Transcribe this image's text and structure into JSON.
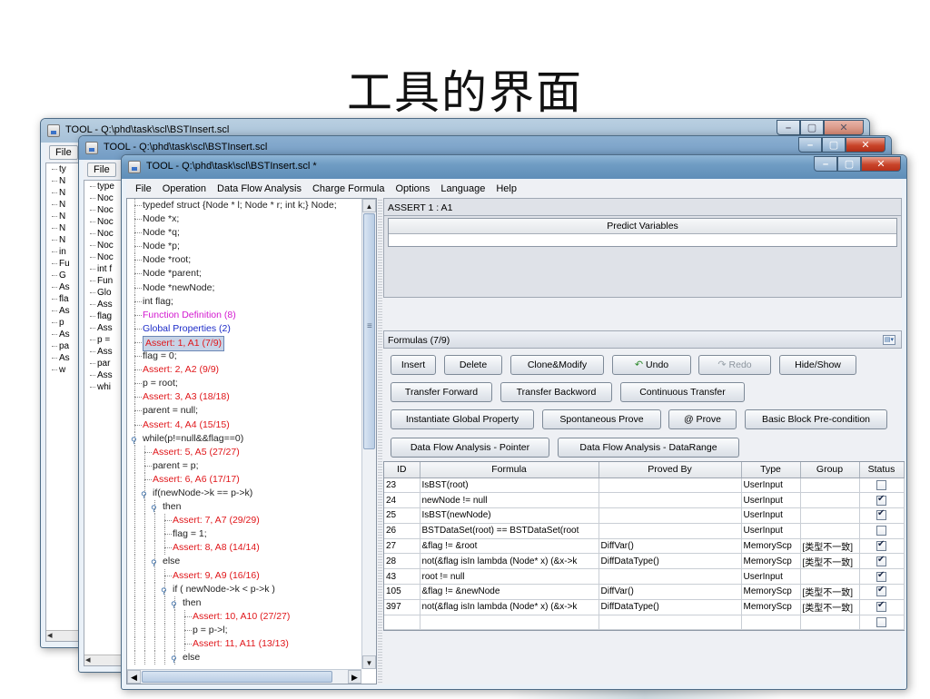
{
  "slide": {
    "title": "工具的界面"
  },
  "windows": {
    "back1": {
      "title": "TOOL - Q:\\phd\\task\\scl\\BSTInsert.scl",
      "menu_file": "File",
      "tree_lines": [
        "ty",
        "N",
        "N",
        "N",
        "N",
        "N",
        "N",
        "in",
        "Fu",
        "G",
        "As",
        "fla",
        "As",
        "p",
        "As",
        "pa",
        "As",
        "w"
      ]
    },
    "back2": {
      "title": "TOOL - Q:\\phd\\task\\scl\\BSTInsert.scl",
      "menu_file": "File",
      "tree_lines": [
        "type",
        "Noc",
        "Noc",
        "Noc",
        "Noc",
        "Noc",
        "Noc",
        "int f",
        "Fun",
        "Glo",
        "Ass",
        "flag",
        "Ass",
        "p =",
        "Ass",
        "par",
        "Ass",
        "whi"
      ]
    },
    "front": {
      "title": "TOOL - Q:\\phd\\task\\scl\\BSTInsert.scl *",
      "menu": [
        "File",
        "Operation",
        "Data Flow Analysis",
        "Charge Formula",
        "Options",
        "Language",
        "Help"
      ]
    }
  },
  "tree": [
    {
      "text": "typedef struct {Node * l; Node * r; int k;} Node;",
      "level": 0,
      "color": "default"
    },
    {
      "text": "Node *x;",
      "level": 0,
      "color": "default"
    },
    {
      "text": "Node *q;",
      "level": 0,
      "color": "default"
    },
    {
      "text": "Node *p;",
      "level": 0,
      "color": "default"
    },
    {
      "text": "Node *root;",
      "level": 0,
      "color": "default"
    },
    {
      "text": "Node *parent;",
      "level": 0,
      "color": "default"
    },
    {
      "text": "Node *newNode;",
      "level": 0,
      "color": "default"
    },
    {
      "text": "int flag;",
      "level": 0,
      "color": "default"
    },
    {
      "text": "Function Definition (8)",
      "level": 0,
      "color": "magenta"
    },
    {
      "text": "Global Properties (2)",
      "level": 0,
      "color": "blue"
    },
    {
      "text": "Assert: 1, A1 (7/9)",
      "level": 0,
      "color": "red",
      "selected": true
    },
    {
      "text": "flag = 0;",
      "level": 0,
      "color": "default"
    },
    {
      "text": "Assert: 2, A2 (9/9)",
      "level": 0,
      "color": "red"
    },
    {
      "text": "p = root;",
      "level": 0,
      "color": "default"
    },
    {
      "text": "Assert: 3, A3 (18/18)",
      "level": 0,
      "color": "red"
    },
    {
      "text": "parent = null;",
      "level": 0,
      "color": "default"
    },
    {
      "text": "Assert: 4, A4 (15/15)",
      "level": 0,
      "color": "red"
    },
    {
      "text": "while(p!=null&&flag==0)",
      "level": 0,
      "color": "default",
      "expand": true
    },
    {
      "text": "Assert: 5, A5 (27/27)",
      "level": 1,
      "color": "red"
    },
    {
      "text": "parent = p;",
      "level": 1,
      "color": "default"
    },
    {
      "text": "Assert: 6, A6 (17/17)",
      "level": 1,
      "color": "red"
    },
    {
      "text": "if(newNode->k == p->k)",
      "level": 1,
      "color": "default",
      "expand": true
    },
    {
      "text": "then",
      "level": 2,
      "color": "default",
      "expand": true
    },
    {
      "text": "Assert: 7, A7 (29/29)",
      "level": 3,
      "color": "red"
    },
    {
      "text": "flag = 1;",
      "level": 3,
      "color": "default"
    },
    {
      "text": "Assert: 8, A8 (14/14)",
      "level": 3,
      "color": "red"
    },
    {
      "text": "else",
      "level": 2,
      "color": "default",
      "expand": true
    },
    {
      "text": "Assert: 9, A9 (16/16)",
      "level": 3,
      "color": "red"
    },
    {
      "text": "if ( newNode->k < p->k )",
      "level": 3,
      "color": "default",
      "expand": true
    },
    {
      "text": "then",
      "level": 4,
      "color": "default",
      "expand": true
    },
    {
      "text": "Assert: 10, A10 (27/27)",
      "level": 5,
      "color": "red"
    },
    {
      "text": "p = p->l;",
      "level": 5,
      "color": "default"
    },
    {
      "text": "Assert: 11, A11 (13/13)",
      "level": 5,
      "color": "red"
    },
    {
      "text": "else",
      "level": 4,
      "color": "default",
      "expand": true
    }
  ],
  "assert_panel": {
    "header": "ASSERT 1 : A1",
    "predict_header": "Predict Variables"
  },
  "formulas_panel": {
    "title": "Formulas (7/9)"
  },
  "buttons": {
    "insert": "Insert",
    "delete": "Delete",
    "clone_modify": "Clone&Modify",
    "undo": "Undo",
    "redo": "Redo",
    "hide_show": "Hide/Show",
    "transfer_forward": "Transfer Forward",
    "transfer_backword": "Transfer Backword",
    "continuous_transfer": "Continuous Transfer",
    "instantiate_global_property": "Instantiate Global Property",
    "spontaneous_prove": "Spontaneous Prove",
    "at_prove": "@ Prove",
    "basic_block_precondition": "Basic Block Pre-condition",
    "dfa_pointer": "Data Flow Analysis - Pointer",
    "dfa_datarange": "Data Flow Analysis - DataRange"
  },
  "table": {
    "columns": [
      "ID",
      "Formula",
      "Proved By",
      "Type",
      "Group",
      "Status"
    ],
    "rows": [
      {
        "id": "23",
        "formula": "IsBST(root)",
        "proved_by": "",
        "type": "UserInput",
        "group": "",
        "status": false
      },
      {
        "id": "24",
        "formula": "newNode != null",
        "proved_by": "",
        "type": "UserInput",
        "group": "",
        "status": true
      },
      {
        "id": "25",
        "formula": "IsBST(newNode)",
        "proved_by": "",
        "type": "UserInput",
        "group": "",
        "status": true
      },
      {
        "id": "26",
        "formula": "BSTDataSet(root) == BSTDataSet(root",
        "proved_by": "",
        "type": "UserInput",
        "group": "",
        "status": false
      },
      {
        "id": "27",
        "formula": "&flag != &root",
        "proved_by": "DiffVar()",
        "type": "MemoryScp",
        "group": "[类型不一致]",
        "status": true
      },
      {
        "id": "28",
        "formula": "not(&flag isIn lambda (Node* x) (&x->k",
        "proved_by": "DiffDataType()",
        "type": "MemoryScp",
        "group": "[类型不一致]",
        "status": true
      },
      {
        "id": "43",
        "formula": "root != null",
        "proved_by": "",
        "type": "UserInput",
        "group": "",
        "status": true
      },
      {
        "id": "105",
        "formula": "&flag != &newNode",
        "proved_by": "DiffVar()",
        "type": "MemoryScp",
        "group": "[类型不一致]",
        "status": true
      },
      {
        "id": "397",
        "formula": "not(&flag isIn lambda (Node* x) (&x->k",
        "proved_by": "DiffDataType()",
        "type": "MemoryScp",
        "group": "[类型不一致]",
        "status": true
      },
      {
        "id": "",
        "formula": "",
        "proved_by": "",
        "type": "",
        "group": "",
        "status": false
      }
    ]
  },
  "colors": {
    "red": "#e0161a",
    "magenta": "#d319d0",
    "blue": "#1c2bc8",
    "titlebar": "#6f9cc3"
  }
}
